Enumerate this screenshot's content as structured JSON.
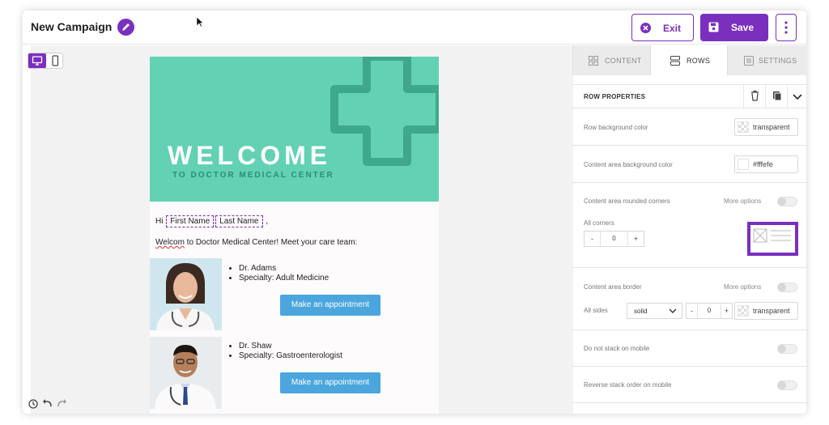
{
  "header": {
    "title": "New Campaign",
    "exit_label": "Exit",
    "save_label": "Save"
  },
  "email": {
    "hero_title": "WELCOME",
    "hero_subtitle": "TO DOCTOR MEDICAL CENTER",
    "greeting_prefix": "Hi",
    "merge_first": "First Name",
    "merge_last": "Last Name",
    "greeting_suffix": ",",
    "intro_misspelled": "Welcom",
    "intro_rest": " to Doctor Medical Center! Meet your care team:",
    "doctors": [
      {
        "name": "Dr. Adams",
        "specialty": "Specialty: Adult Medicine",
        "button": "Make an appointment"
      },
      {
        "name": "Dr. Shaw",
        "specialty": "Specialty: Gastroenterologist",
        "button": "Make an appointment"
      }
    ]
  },
  "panel": {
    "tabs": [
      {
        "label": "CONTENT"
      },
      {
        "label": "ROWS"
      },
      {
        "label": "SETTINGS"
      }
    ],
    "active_tab": "ROWS",
    "section_title": "ROW PROPERTIES",
    "row_bg_label": "Row background color",
    "row_bg_value": "transparent",
    "content_bg_label": "Content area background color",
    "content_bg_value": "#fffefe",
    "rounded_label": "Content area rounded corners",
    "more_options": "More options",
    "all_corners_label": "All corners",
    "corners_value": "0",
    "border_label": "Content area border",
    "all_sides_label": "All sides",
    "border_style": "solid",
    "border_width": "0",
    "border_color": "transparent",
    "no_stack_label": "Do not stack on mobile",
    "reverse_stack_label": "Reverse stack order on mobile"
  },
  "colors": {
    "accent": "#7b2fbf",
    "hero_bg": "#62d1b4",
    "button_blue": "#4aa6dd"
  }
}
